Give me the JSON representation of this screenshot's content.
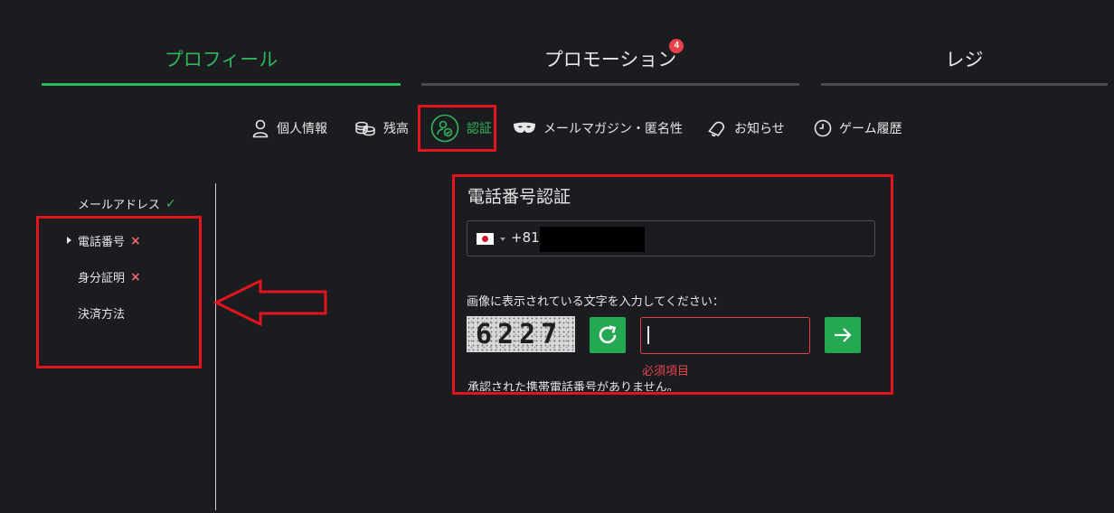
{
  "top_tabs": [
    {
      "label": "プロフィール",
      "active": true
    },
    {
      "label": "プロモーション",
      "badge": "4"
    },
    {
      "label": "レジ"
    }
  ],
  "sub_tabs": [
    {
      "label": "個人情報",
      "icon": "person-icon"
    },
    {
      "label": "残高",
      "icon": "coins-icon"
    },
    {
      "label": "認証",
      "icon": "verified-user-icon",
      "active": true
    },
    {
      "label": "メールマガジン・匿名性",
      "icon": "mask-icon"
    },
    {
      "label": "お知らせ",
      "icon": "bell-icon"
    },
    {
      "label": "ゲーム履歴",
      "icon": "clock-icon"
    }
  ],
  "left_nav": [
    {
      "label": "メールアドレス",
      "status": "verified"
    },
    {
      "label": "電話番号",
      "status": "unverified",
      "selected": true
    },
    {
      "label": "身分証明",
      "status": "unverified"
    },
    {
      "label": "決済方法"
    }
  ],
  "status_marks": {
    "verified": "✓",
    "unverified": "×"
  },
  "panel": {
    "title": "電話番号認証",
    "country_flag": "japan-flag-icon",
    "dial_code": "+81",
    "captcha_label": "画像に表示されている文字を入力してください：",
    "captcha_text": "6227",
    "code_value": "",
    "required_text": "必須項目",
    "status_text": "承認された携帯電話番号がありません。"
  },
  "colors": {
    "accent": "#2fb55a",
    "button": "#24a852",
    "error": "#e3434b",
    "annotation": "#e3141c",
    "background": "#1b1c20"
  }
}
